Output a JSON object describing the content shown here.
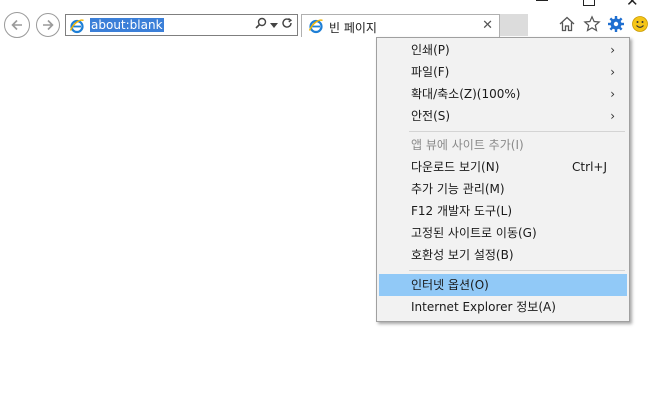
{
  "address_bar": {
    "url": "about:blank"
  },
  "tab": {
    "title": "빈 페이지"
  },
  "menu": {
    "items": [
      {
        "label": "인쇄(P)",
        "submenu": true
      },
      {
        "label": "파일(F)",
        "submenu": true
      },
      {
        "label": "확대/축소(Z)(100%)",
        "submenu": true
      },
      {
        "label": "안전(S)",
        "submenu": true
      },
      {
        "label": "앱 뷰에 사이트 추가(I)",
        "disabled": true
      },
      {
        "label": "다운로드 보기(N)",
        "shortcut": "Ctrl+J"
      },
      {
        "label": "추가 기능 관리(M)"
      },
      {
        "label": "F12 개발자 도구(L)"
      },
      {
        "label": "고정된 사이트로 이동(G)"
      },
      {
        "label": "호환성 보기 설정(B)"
      },
      {
        "label": "인터넷 옵션(O)",
        "highlighted": true
      },
      {
        "label": "Internet Explorer 정보(A)"
      }
    ]
  },
  "colors": {
    "highlight": "#91c9f7",
    "url_selection": "#3b7fd8",
    "gear": "#1f6fd0"
  }
}
